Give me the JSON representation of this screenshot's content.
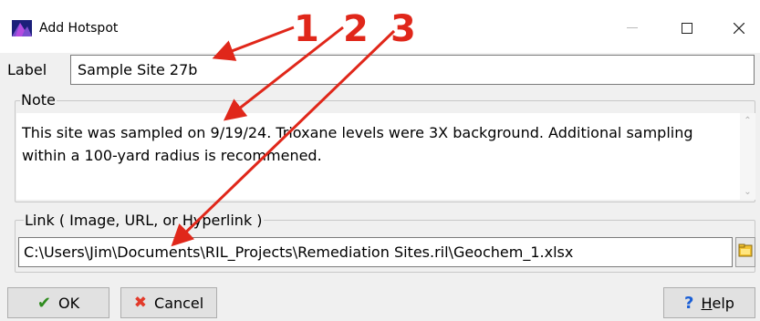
{
  "window": {
    "title": "Add Hotspot"
  },
  "label_field": {
    "caption": "Label",
    "value": "Sample Site 27b"
  },
  "note_group": {
    "legend": "Note",
    "text": "This site was sampled on 9/19/24.  Trioxane levels were 3X background.  Additional sampling within a 100-yard radius is recommened."
  },
  "link_group": {
    "legend": "Link ( Image, URL, or Hyperlink )",
    "value": "C:\\Users\\Jim\\Documents\\RIL_Projects\\Remediation Sites.ril\\Geochem_1.xlsx"
  },
  "buttons": {
    "ok": "OK",
    "cancel": "Cancel",
    "help_h": "H",
    "help_rest": "elp"
  },
  "annotations": {
    "one": "1",
    "two": "2",
    "three": "3",
    "color": "#e0271a"
  },
  "icons": {
    "app": "app-logo-icon",
    "ok": "checkmark-icon",
    "cancel": "x-icon",
    "help": "question-icon",
    "browse": "folder-icon"
  }
}
